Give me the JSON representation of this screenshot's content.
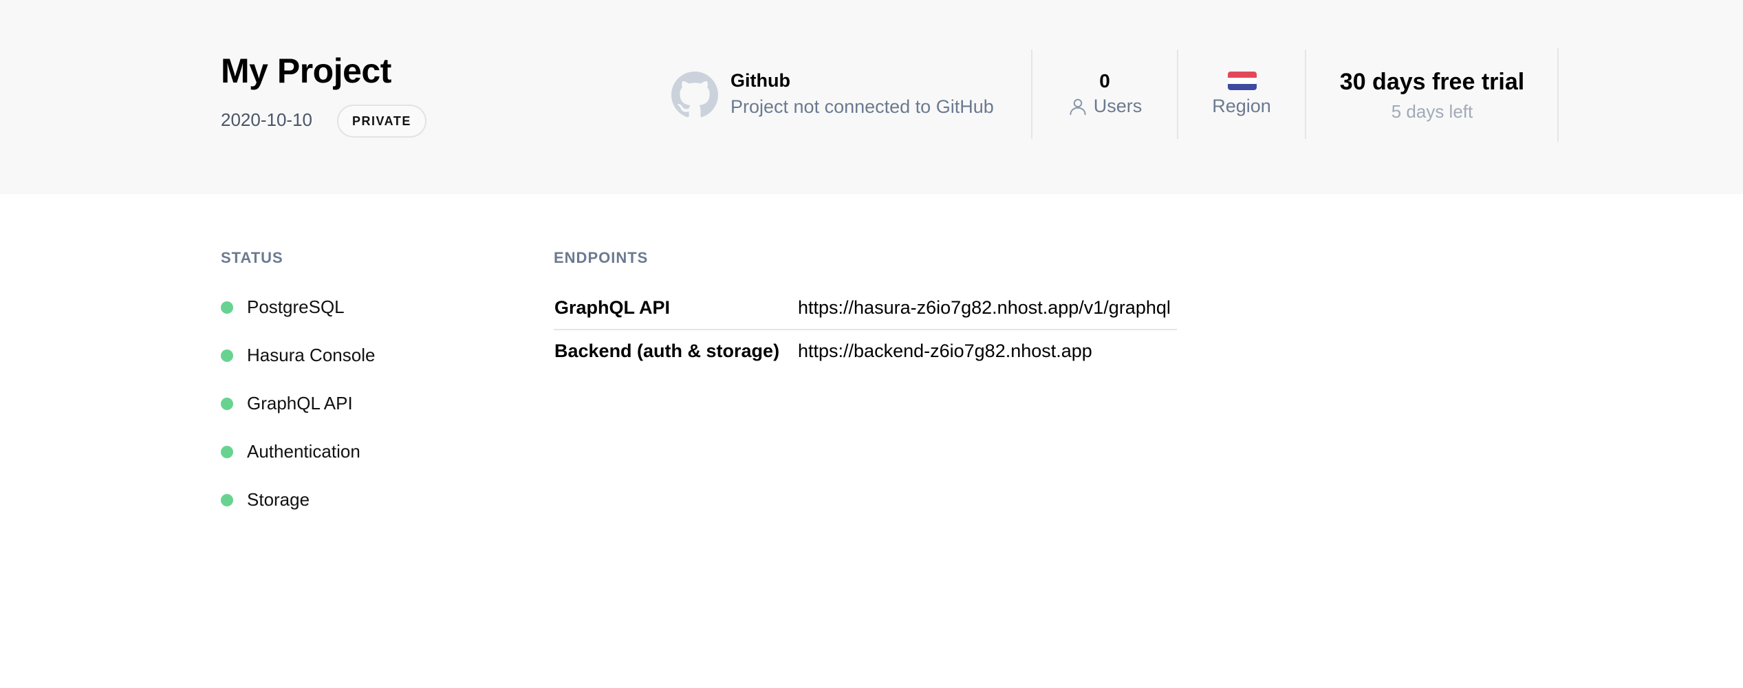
{
  "project": {
    "title": "My Project",
    "date": "2020-10-10",
    "visibility": "PRIVATE"
  },
  "github": {
    "icon": "github-icon",
    "title": "Github",
    "status": "Project not connected to GitHub"
  },
  "users": {
    "count": "0",
    "icon": "user-icon",
    "label": "Users"
  },
  "region": {
    "icon": "netherlands-flag-icon",
    "flag_colors": [
      "#e3485a",
      "#ffffff",
      "#3e4aa0"
    ],
    "label": "Region"
  },
  "trial": {
    "title": "30 days free trial",
    "remaining": "5 days left"
  },
  "status": {
    "heading": "STATUS",
    "dot_color": "#68d391",
    "items": [
      {
        "label": "PostgreSQL"
      },
      {
        "label": "Hasura Console"
      },
      {
        "label": "GraphQL API"
      },
      {
        "label": "Authentication"
      },
      {
        "label": "Storage"
      }
    ]
  },
  "endpoints": {
    "heading": "ENDPOINTS",
    "items": [
      {
        "name": "GraphQL API",
        "url": "https://hasura-z6io7g82.nhost.app/v1/graphql"
      },
      {
        "name": "Backend (auth & storage)",
        "url": "https://backend-z6io7g82.nhost.app"
      }
    ]
  }
}
